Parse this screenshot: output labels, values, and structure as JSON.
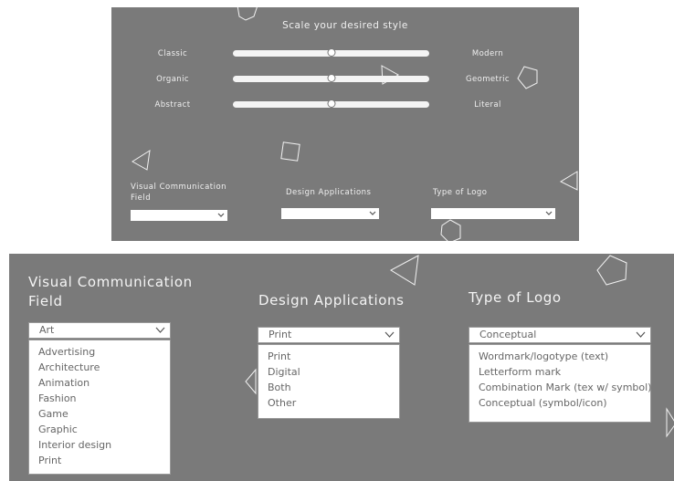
{
  "top_panel": {
    "title": "Scale your desired style",
    "sliders": [
      {
        "left": "Classic",
        "right": "Modern",
        "value": 0.5
      },
      {
        "left": "Organic",
        "right": "Geometric",
        "value": 0.5
      },
      {
        "left": "Abstract",
        "right": "Literal",
        "value": 0.5
      }
    ],
    "fields": [
      {
        "label_line1": "Visual Communication",
        "label_line2": "Field",
        "value": ""
      },
      {
        "label": "Design Applications",
        "value": ""
      },
      {
        "label": "Type of Logo",
        "value": ""
      }
    ]
  },
  "bottom_panel": {
    "visual_communication": {
      "label_line1": "Visual Communication",
      "label_line2": "Field",
      "selected": "Art",
      "options": [
        "Advertising",
        "Architecture",
        "Animation",
        "Fashion",
        "Game",
        "Graphic",
        "Interior design",
        "Print"
      ]
    },
    "design_applications": {
      "label": "Design Applications",
      "selected": "Print",
      "options": [
        "Print",
        "Digital",
        "Both",
        "Other"
      ]
    },
    "type_of_logo": {
      "label": "Type of Logo",
      "selected": "Conceptual",
      "options": [
        "Wordmark/logotype (text)",
        "Letterform mark",
        "Combination Mark (tex w/ symbol)",
        "Conceptual (symbol/icon)"
      ]
    }
  },
  "icons": [
    "chevron-down-icon",
    "triangle-outline",
    "pentagon-outline",
    "square-outline"
  ],
  "colors": {
    "panel": "#7a7a7a",
    "text": "#f0f0f0",
    "option_text": "#666666",
    "background": "#ffffff"
  }
}
